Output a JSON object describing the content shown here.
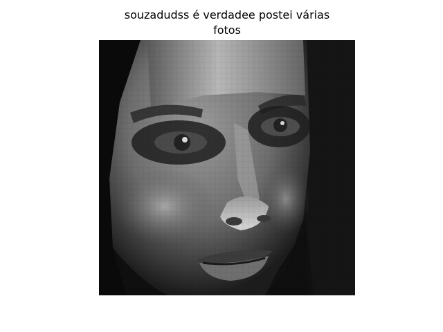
{
  "figure": {
    "title_line1": "souzadudss é verdadee postei várias",
    "title_line2": "fotos",
    "image": {
      "subject": "grayscale pixelated close-up of a face",
      "colormap": "gray"
    }
  }
}
